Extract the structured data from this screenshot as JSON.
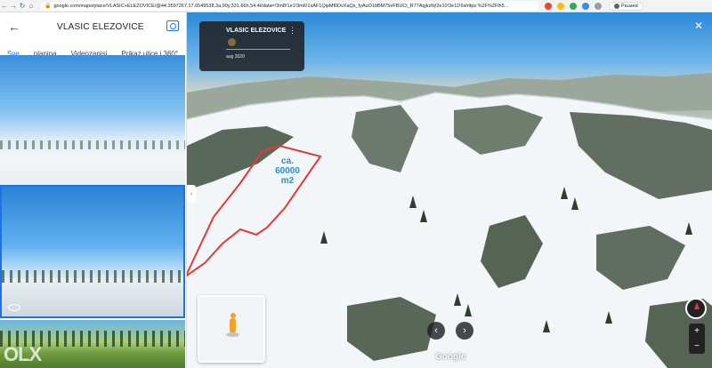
{
  "browser": {
    "url": "google.com/maps/place/VLASIC+ELEZOVICE/@44.3597267,17.6549538,3a,90y,331.66h,54.4t/data=!3m8!1e1!3m6!1sAF1QipMf0DvXaQs_fyAuO1bBM75eFBUCl_R77Aqjkzfq!2e10!3e11!6shttps:%2F%2Flh5...",
    "profile_label": "Paused"
  },
  "sidebar": {
    "title": "VLASIC ELEZOVICE",
    "tabs": [
      {
        "label": "Sve",
        "active": true
      },
      {
        "label": "planina",
        "active": false
      },
      {
        "label": "Videozapisi",
        "active": false
      },
      {
        "label": "Prikaz ulice i 360°",
        "active": false
      }
    ],
    "watermark": "OLX"
  },
  "viewer": {
    "place_name": "VLASIC ELEZOVICE",
    "date": "aug 2020",
    "annotation_lines": [
      "ca.",
      "60000",
      "m2"
    ],
    "annotation_color": "#e53935",
    "brand": "Google"
  },
  "colors": {
    "accent": "#1a73e8",
    "annotation_text": "#1e8fe0"
  }
}
